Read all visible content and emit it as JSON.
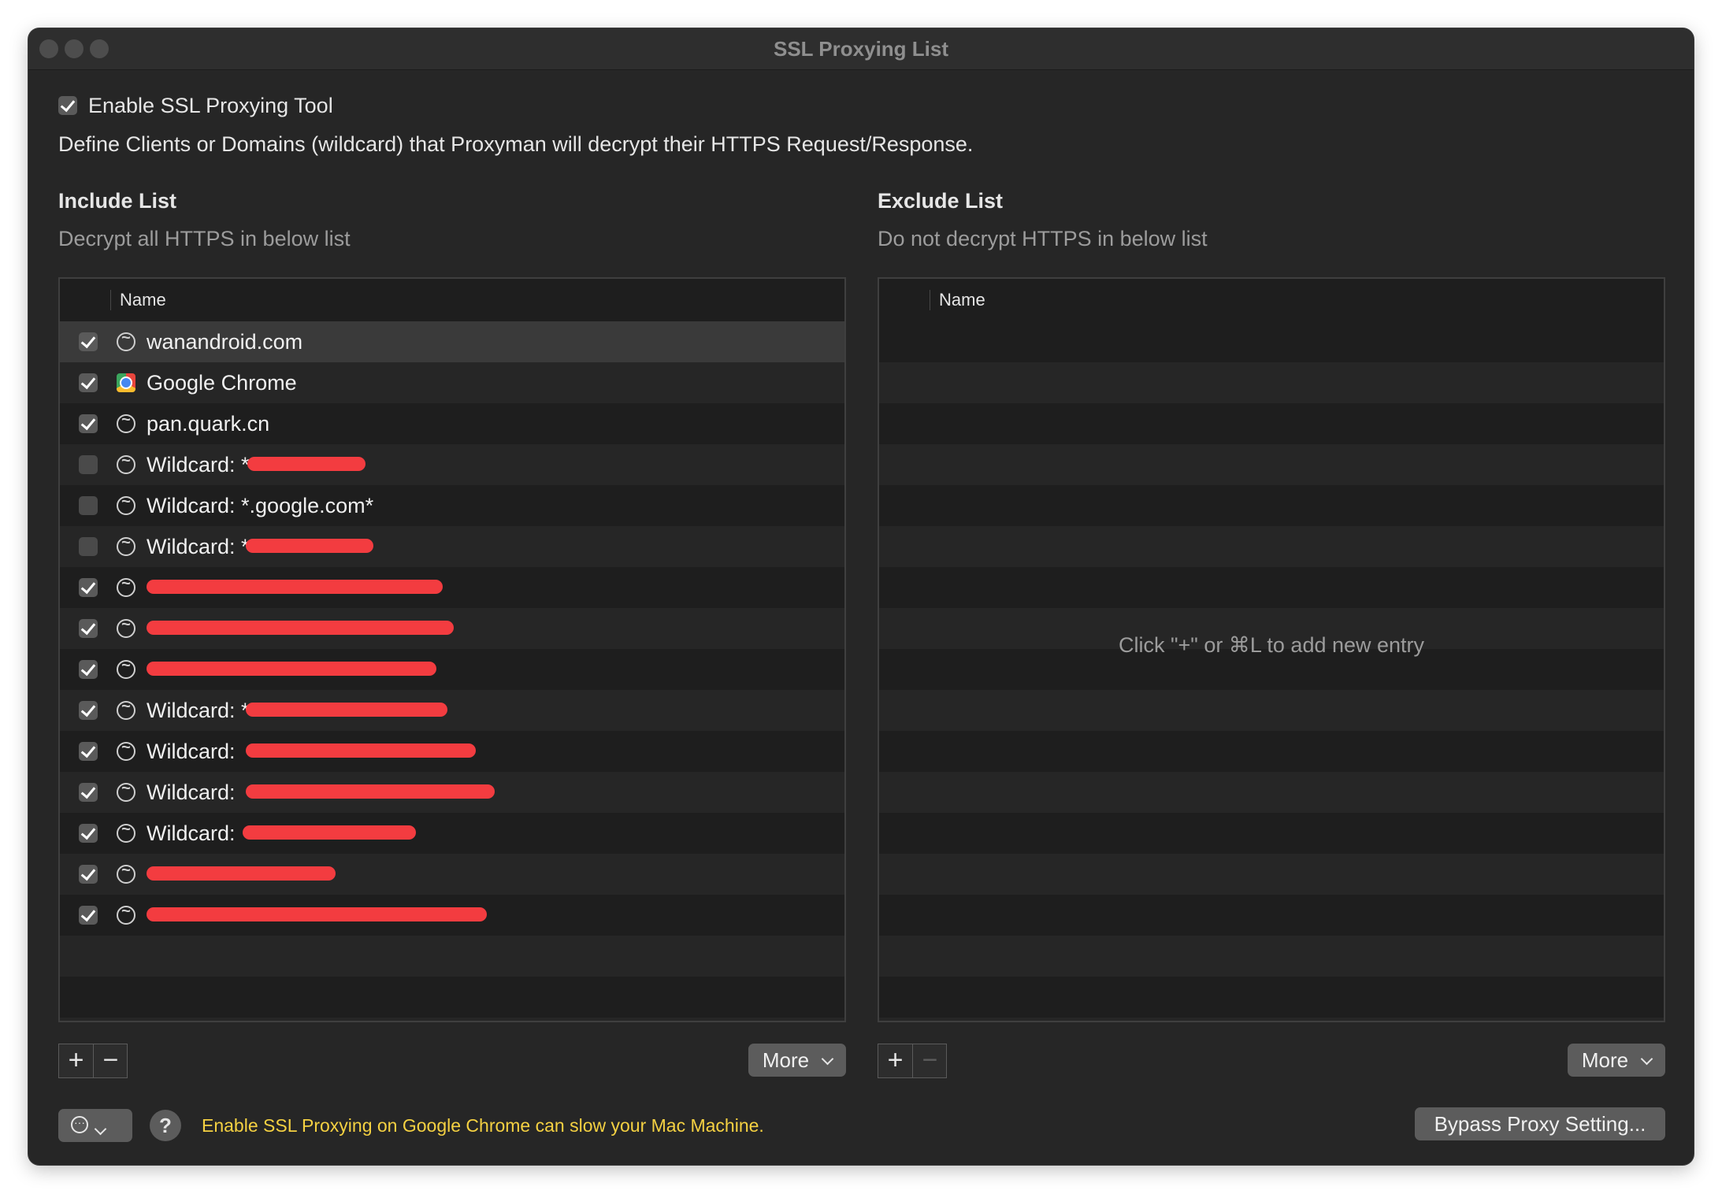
{
  "window": {
    "title": "SSL Proxying List"
  },
  "enable": {
    "label": "Enable SSL Proxying Tool",
    "checked": true
  },
  "description": "Define Clients or Domains (wildcard) that Proxyman will decrypt their HTTPS Request/Response.",
  "include": {
    "heading": "Include List",
    "subheading": "Decrypt all HTTPS in below list",
    "column": "Name",
    "rows": [
      {
        "checked": true,
        "icon": "domain-icon",
        "label": "wanandroid.com"
      },
      {
        "checked": true,
        "icon": "chrome-icon",
        "label": "Google Chrome"
      },
      {
        "checked": true,
        "icon": "domain-icon",
        "label": "pan.quark.cn"
      },
      {
        "checked": false,
        "icon": "domain-icon",
        "label": "Wildcard: *"
      },
      {
        "checked": false,
        "icon": "domain-icon",
        "label": "Wildcard: *.google.com*"
      },
      {
        "checked": false,
        "icon": "domain-icon",
        "label": "Wildcard: *"
      },
      {
        "checked": true,
        "icon": "domain-icon",
        "label": ""
      },
      {
        "checked": true,
        "icon": "domain-icon",
        "label": ""
      },
      {
        "checked": true,
        "icon": "domain-icon",
        "label": ""
      },
      {
        "checked": true,
        "icon": "domain-icon",
        "label": "Wildcard: *"
      },
      {
        "checked": true,
        "icon": "domain-icon",
        "label": "Wildcard: "
      },
      {
        "checked": true,
        "icon": "domain-icon",
        "label": "Wildcard: "
      },
      {
        "checked": true,
        "icon": "domain-icon",
        "label": "Wildcard: "
      },
      {
        "checked": true,
        "icon": "domain-icon",
        "label": ""
      },
      {
        "checked": true,
        "icon": "domain-icon",
        "label": ""
      }
    ],
    "more_label": "More"
  },
  "exclude": {
    "heading": "Exclude List",
    "subheading": "Do not decrypt HTTPS in below list",
    "column": "Name",
    "empty_hint": "Click \"+\" or ⌘L to add new entry",
    "more_label": "More"
  },
  "toolbar": {
    "add": "+",
    "remove": "−"
  },
  "footer": {
    "help": "?",
    "warning": "Enable SSL Proxying on Google Chrome can slow your Mac Machine.",
    "bypass_label": "Bypass Proxy Setting..."
  },
  "colors": {
    "warning": "#f5d142",
    "redaction": "#f33c40",
    "window_bg": "#262626"
  }
}
